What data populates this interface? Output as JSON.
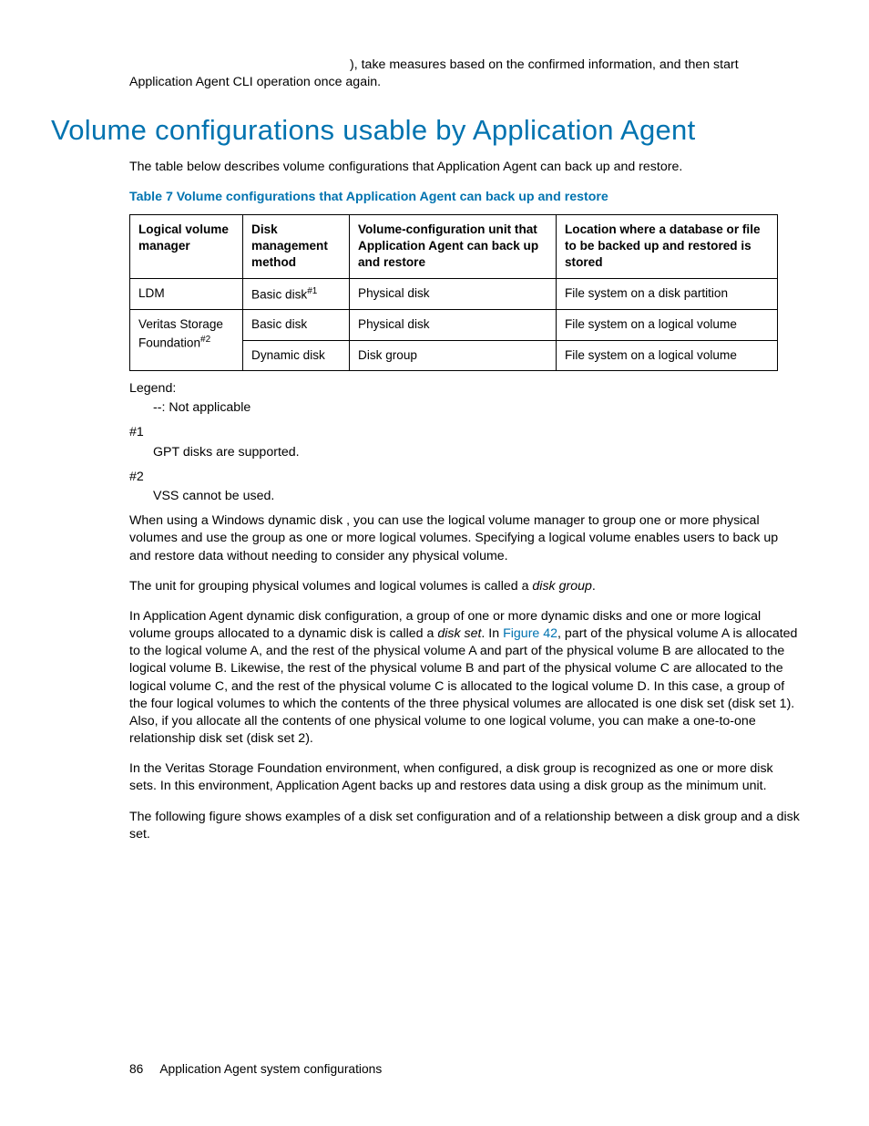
{
  "intro_fragment_suffix": "), take measures based on the confirmed information, and then start Application Agent CLI operation once again.",
  "heading": "Volume configurations usable by Application Agent",
  "lead_para": "The table below describes volume configurations that Application Agent can back up and restore.",
  "table_caption": "Table 7 Volume configurations that Application Agent can back up and restore",
  "table": {
    "headers": {
      "c1": "Logical volume manager",
      "c2": "Disk management method",
      "c3": "Volume-configuration unit that Application Agent can back up and restore",
      "c4": "Location where a database or file to be backed up and restored is stored"
    },
    "r1": {
      "c1": "LDM",
      "c2_pre": "Basic disk",
      "c2_sup": "#1",
      "c3": "Physical disk",
      "c4": "File system on a disk partition"
    },
    "r2c1_pre": "Veritas Storage Foundation",
    "r2c1_sup": "#2",
    "r2": {
      "c2": "Basic disk",
      "c3": "Physical disk",
      "c4": "File system on a logical volume"
    },
    "r3": {
      "c2": "Dynamic disk",
      "c3": "Disk group",
      "c4": "File system on a logical volume"
    }
  },
  "legend": {
    "label": "Legend:",
    "na": "--: Not applicable",
    "fn1_label": "#1",
    "fn1_body": "GPT disks are supported.",
    "fn2_label": "#2",
    "fn2_body": "VSS cannot be used."
  },
  "body": {
    "p1": "When using a Windows dynamic disk , you can use the logical volume manager to group one or more physical volumes and use the group as one or more logical volumes. Specifying a logical volume enables users to back up and restore data without needing to consider any physical volume.",
    "p2_pre": "The unit for grouping physical volumes and logical volumes is called a ",
    "p2_em": "disk group",
    "p2_post": ".",
    "p3_pre": "In Application Agent dynamic disk configuration, a group of one or more dynamic disks and one or more logical volume groups allocated to a dynamic disk is called a ",
    "p3_em": "disk set",
    "p3_mid": ". In ",
    "p3_link": "Figure 42",
    "p3_post": ", part of the physical volume A is allocated to the logical volume A, and the rest of the physical volume A and part of the physical volume B are allocated to the logical volume B. Likewise, the rest of the physical volume B and part of the physical volume C are allocated to the logical volume C, and the rest of the physical volume C is allocated to the logical volume D. In this case, a group of the four logical volumes to which the contents of the three physical volumes are allocated is one disk set (disk set 1). Also, if you allocate all the contents of one physical volume to one logical volume, you can make a one-to-one relationship disk set (disk set 2).",
    "p4": "In the Veritas Storage Foundation environment, when configured, a disk group is recognized as one or more disk sets. In this environment, Application Agent backs up and restores data using a disk group as the minimum unit.",
    "p5": "The following figure shows examples of a disk set configuration and of a relationship between a disk group and a disk set."
  },
  "footer": {
    "page": "86",
    "title": "Application Agent system configurations"
  }
}
